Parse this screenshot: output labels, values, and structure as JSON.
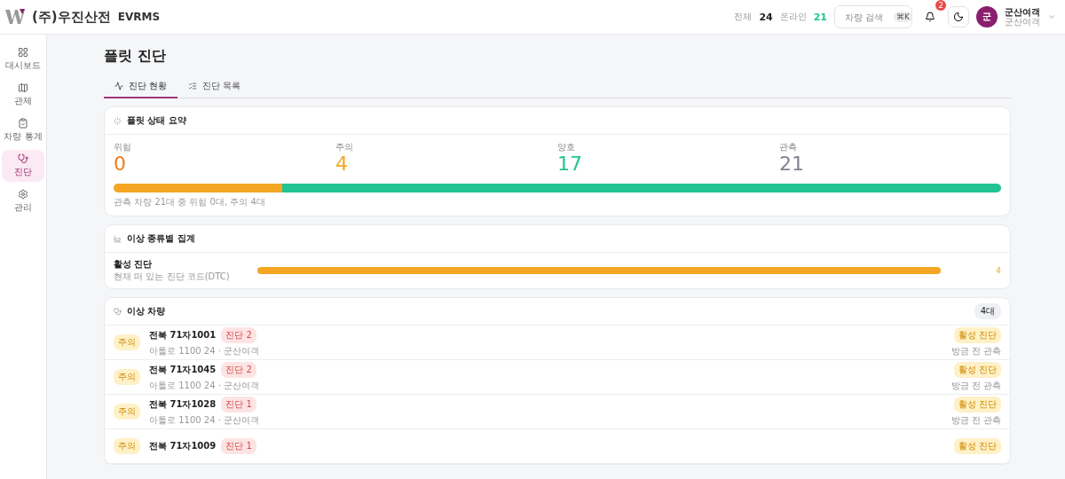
{
  "header": {
    "logo_text": "(주)우진산전",
    "product": "EVRMS",
    "total_label": "전체",
    "total": "24",
    "online_label": "온라인",
    "online": "21",
    "search_placeholder": "차량 검색",
    "search_shortcut": "⌘K",
    "notifications": "2",
    "user_initial": "군",
    "user_name": "군산여객",
    "user_sub": "군산여객"
  },
  "sidebar": {
    "items": [
      {
        "label": "대시보드",
        "selected": false
      },
      {
        "label": "관제",
        "selected": false
      },
      {
        "label": "차량 통계",
        "selected": false
      },
      {
        "label": "진단",
        "selected": true
      },
      {
        "label": "관리",
        "selected": false
      }
    ]
  },
  "page": {
    "title": "플릿 진단"
  },
  "tabs": [
    {
      "label": "진단 현황",
      "selected": true
    },
    {
      "label": "진단 목록",
      "selected": false
    }
  ],
  "summary": {
    "title": "플릿 상태 요약",
    "stats": [
      {
        "label": "위험",
        "value": "0",
        "color": "#f07f1c"
      },
      {
        "label": "주의",
        "value": "4",
        "color": "#f5a623"
      },
      {
        "label": "양호",
        "value": "17",
        "color": "#22c493"
      },
      {
        "label": "관측",
        "value": "21",
        "color": "#808590"
      }
    ],
    "bar": [
      {
        "level": 0.19,
        "color": "#f5a623"
      },
      {
        "level": 0.81,
        "color": "#22c493"
      }
    ],
    "note": "관측 차량 21대 중 위험 0대, 주의 4대"
  },
  "anomaly_types": {
    "title": "이상 종류별 집계",
    "rows": [
      {
        "name": "활성 진단",
        "desc": "현재 떠 있는 진단 코드(DTC)",
        "level": 1,
        "count": "4"
      }
    ]
  },
  "vehicles": {
    "title": "이상 차량",
    "count": "4대",
    "rows": [
      {
        "status": "주의",
        "plate": "전북 71자1001",
        "badge": "진단 2",
        "sub": "아톨로 1100 24 · 군산여객",
        "tag": "활성 진단",
        "time": "방금 전 관측"
      },
      {
        "status": "주의",
        "plate": "전북 71자1045",
        "badge": "진단 2",
        "sub": "아톨로 1100 24 · 군산여객",
        "tag": "활성 진단",
        "time": "방금 전 관측"
      },
      {
        "status": "주의",
        "plate": "전북 71자1028",
        "badge": "진단 1",
        "sub": "아톨로 1100 24 · 군산여객",
        "tag": "활성 진단",
        "time": "방금 전 관측"
      },
      {
        "status": "주의",
        "plate": "전북 71자1009",
        "badge": "진단 1",
        "tag": "활성 진단"
      }
    ]
  }
}
